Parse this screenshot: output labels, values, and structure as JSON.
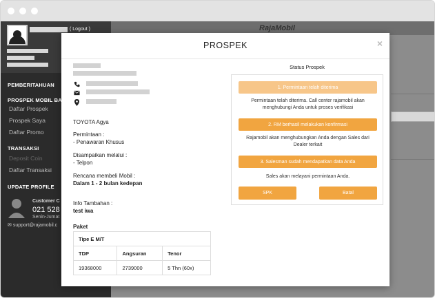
{
  "sidebar": {
    "logout_label": "( Logout )",
    "sections": {
      "pemberitahuan": "PEMBERITAHUAN",
      "prospek": "PROSPEK MOBIL BAR",
      "transaksi": "TRANSAKSI",
      "update": "UPDATE PROFILE"
    },
    "items": {
      "daftar_prospek": "Daftar Prospek",
      "prospek_saya": "Prospek Saya",
      "daftar_promo": "Daftar Promo",
      "deposit_coin": "Deposit Coin",
      "daftar_transaksi": "Daftar Transaksi"
    },
    "contact": {
      "label": "Customer C",
      "phone": "021 528",
      "hours": "Senin-Jumat",
      "email": "support@rajamobil.c"
    }
  },
  "background": {
    "brand": "RajaMobil"
  },
  "modal": {
    "title": "PROSPEK",
    "close_icon": "×",
    "car": "TOYOTA Agya",
    "permintaan_label": "Permintaan :",
    "permintaan_value": "- Penawaran Khusus",
    "disampaikan_label": "Disampaikan melalui :",
    "disampaikan_value": "- Telpon",
    "rencana_label": "Rencana membeli Mobil :",
    "rencana_value": "Dalam 1 - 2 bulan kedepan",
    "info_label": "Info Tambahan :",
    "info_value": "test iwa",
    "paket_label": "Paket",
    "paket": {
      "tipe": "Tipe E M/T",
      "headers": [
        "TDP",
        "Angsuran",
        "Tenor"
      ],
      "row": [
        "19368000",
        "2739000",
        "5 Thn (60x)"
      ]
    }
  },
  "status": {
    "title": "Status Prospek",
    "step1": "1. Permintaan telah diterima",
    "step1_desc": "Permintaan telah diterima. Call center rajamobil akan menghubungi Anda untuk proses verifikasi",
    "step2": "2. RM berhasil melakukan konfirmasi",
    "step2_desc": "Rajamobil akan menghubungkan Anda dengan Sales dari Dealer terkait",
    "step3": "3. Salesman sudah mendapatkan data Anda",
    "step3_desc": "Sales akan melayani permintaan Anda.",
    "spk": "SPK",
    "batal": "Batal",
    "colors": {
      "step1": "#f7c689",
      "active": "#f1a540"
    }
  }
}
